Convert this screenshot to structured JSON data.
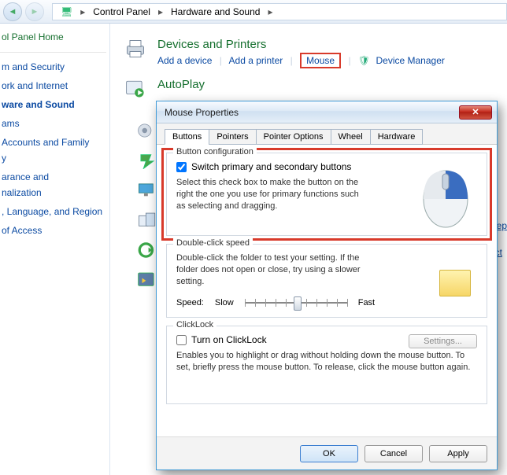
{
  "breadcrumb": {
    "root": "Control Panel",
    "sub": "Hardware and Sound"
  },
  "sidebar": {
    "home": "ol Panel Home",
    "items": [
      {
        "label": "m and Security"
      },
      {
        "label": "ork and Internet"
      },
      {
        "label": "ware and Sound",
        "active": true
      },
      {
        "label": "ams"
      },
      {
        "label": "Accounts and Family"
      },
      {
        "label": "y"
      },
      {
        "label": "arance and"
      },
      {
        "label": "nalization"
      },
      {
        "label": ", Language, and Region"
      },
      {
        "label": "of Access"
      }
    ]
  },
  "sections": {
    "devices": {
      "title": "Devices and Printers",
      "links": [
        "Add a device",
        "Add a printer",
        "Mouse",
        "Device Manager"
      ]
    },
    "autoplay": {
      "title": "AutoPlay"
    }
  },
  "right_links": [
    "sleep",
    "nect"
  ],
  "dialog": {
    "title": "Mouse Properties",
    "tabs": [
      "Buttons",
      "Pointers",
      "Pointer Options",
      "Wheel",
      "Hardware"
    ],
    "groups": {
      "buttons": {
        "legend": "Button configuration",
        "checkbox": "Switch primary and secondary buttons",
        "desc": "Select this check box to make the button on the right the one you use for primary functions such as selecting and dragging."
      },
      "dblclick": {
        "legend": "Double-click speed",
        "desc": "Double-click the folder to test your setting. If the folder does not open or close, try using a slower setting.",
        "speed_label": "Speed:",
        "slow": "Slow",
        "fast": "Fast"
      },
      "clicklock": {
        "legend": "ClickLock",
        "checkbox": "Turn on ClickLock",
        "settings": "Settings...",
        "desc": "Enables you to highlight or drag without holding down the mouse button. To set, briefly press the mouse button. To release, click the mouse button again."
      }
    },
    "buttons": {
      "ok": "OK",
      "cancel": "Cancel",
      "apply": "Apply"
    }
  }
}
